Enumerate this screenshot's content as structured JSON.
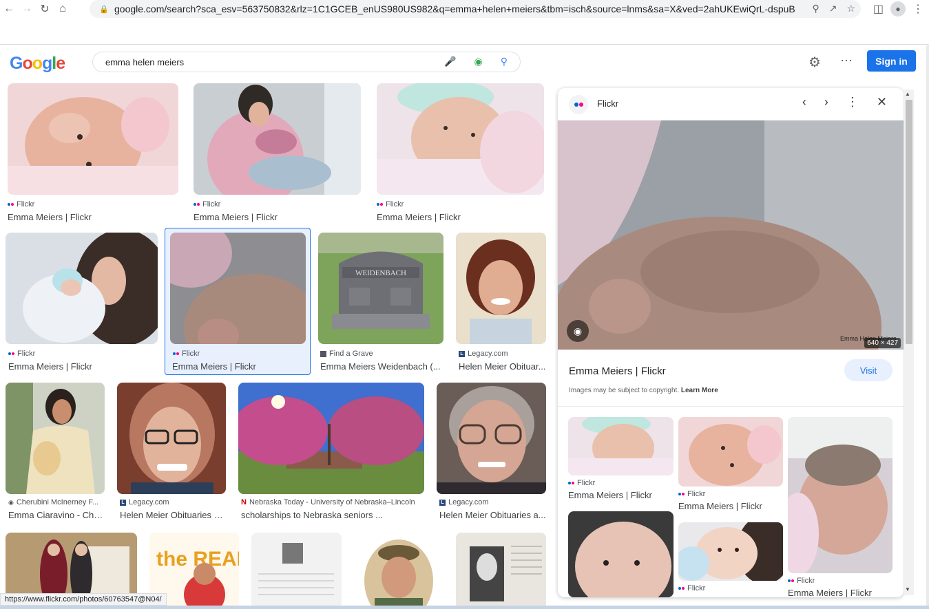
{
  "browser": {
    "url": "google.com/search?sca_esv=563750832&rlz=1C1GCEB_enUS980US982&q=emma+helen+meiers&tbm=isch&source=lnms&sa=X&ved=2ahUKEwiQrL-dspuB..."
  },
  "header": {
    "search_query": "emma helen meiers",
    "signin_label": "Sign in"
  },
  "grid": [
    {
      "source": "Flickr",
      "title": "Emma Meiers | Flickr"
    },
    {
      "source": "Flickr",
      "title": "Emma Meiers | Flickr"
    },
    {
      "source": "Flickr",
      "title": "Emma Meiers | Flickr"
    },
    {
      "source": "Flickr",
      "title": "Emma Meiers | Flickr"
    },
    {
      "source": "Flickr",
      "title": "Emma Meiers | Flickr"
    },
    {
      "source": "Find a Grave",
      "title": "Emma Meiers Weidenbach (..."
    },
    {
      "source": "Legacy.com",
      "title": "Helen Meier Obituar..."
    },
    {
      "source": "Cherubini McInerney F...",
      "title": "Emma Ciaravino - Che..."
    },
    {
      "source": "Legacy.com",
      "title": "Helen Meier Obituaries a..."
    },
    {
      "source": "Nebraska Today - University of Nebraska–Lincoln",
      "title": "scholarships to Nebraska seniors ..."
    },
    {
      "source": "Legacy.com",
      "title": "Helen Meier Obituaries a..."
    }
  ],
  "image_text": {
    "tombstone": "WEIDENBACH",
    "read_cover": "the READ",
    "watermark": "Emma Helen Meiers"
  },
  "panel": {
    "source": "Flickr",
    "dimensions": "640 × 427",
    "title": "Emma Meiers | Flickr",
    "visit_label": "Visit",
    "copyright": "Images may be subject to copyright.",
    "learn_more": "Learn More",
    "related": [
      {
        "source": "Flickr",
        "title": "Emma Meiers | Flickr"
      },
      {
        "source": "Flickr",
        "title": "Emma Meiers | Flickr"
      },
      {
        "source": "Flickr",
        "title": "Emma Meiers | Flickr"
      },
      {
        "source": "Flickr"
      }
    ]
  },
  "status_url": "https://www.flickr.com/photos/60763547@N04/"
}
